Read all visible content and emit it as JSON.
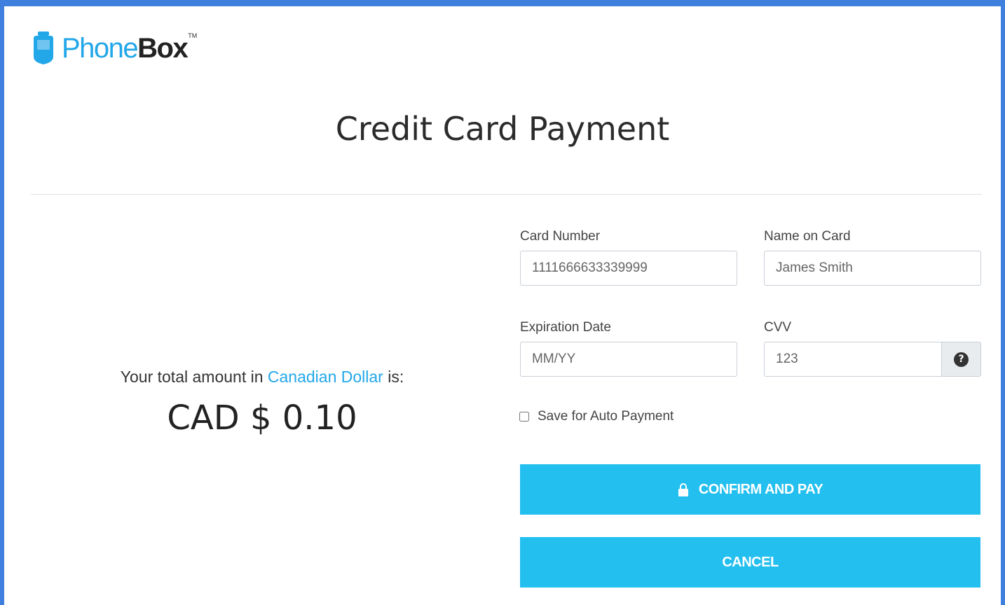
{
  "brand": {
    "name_light": "Phone",
    "name_bold": "Box",
    "trademark": "TM",
    "color": "#22a7e8"
  },
  "page": {
    "title": "Credit Card Payment"
  },
  "summary": {
    "label_prefix": "Your total amount in",
    "currency_name": "Canadian Dollar",
    "label_suffix": "is:",
    "amount": "CAD $ 0.10"
  },
  "form": {
    "card_number": {
      "label": "Card Number",
      "placeholder": "1111666633339999"
    },
    "name_on_card": {
      "label": "Name on Card",
      "placeholder": "James Smith"
    },
    "expiration": {
      "label": "Expiration Date",
      "placeholder": "MM/YY"
    },
    "cvv": {
      "label": "CVV",
      "placeholder": "123",
      "help_glyph": "?"
    },
    "auto_payment": {
      "label": "Save for Auto Payment",
      "checked": false
    },
    "confirm_label": "CONFIRM AND PAY",
    "cancel_label": "CANCEL"
  },
  "colors": {
    "frame": "#3f7fde",
    "button": "#22bfef",
    "accent": "#22a7e8"
  },
  "icons": {
    "logo": "phonebox-logo-icon",
    "help": "question-circle-icon",
    "lock": "lock-icon"
  }
}
